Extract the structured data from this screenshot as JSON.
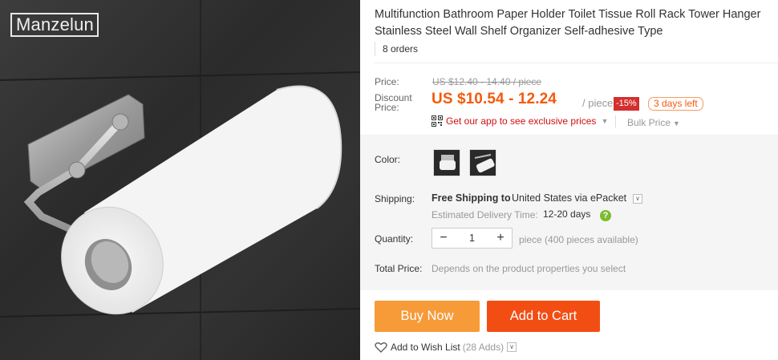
{
  "brand": "Manzelun",
  "product": {
    "title": "Multifunction Bathroom Paper Holder Toilet Tissue Roll Rack Tower Hanger Stainless Steel Wall Shelf Organizer Self-adhesive Type",
    "orders": "8 orders"
  },
  "pricing": {
    "price_label": "Price:",
    "original_price": "US $12.40 - 14.40 / piece",
    "discount_label_1": "Discount",
    "discount_label_2": "Price:",
    "discount_price": "US $10.54 - 12.24",
    "per_piece": "/ piece",
    "discount_badge": "-15%",
    "days_left": "3 days left",
    "app_promo": "Get our app to see exclusive prices",
    "bulk_price": "Bulk Price"
  },
  "options": {
    "color_label": "Color:",
    "shipping_label": "Shipping:",
    "shipping_free": "Free Shipping to",
    "shipping_dest": "United States via ePacket",
    "delivery_label": "Estimated Delivery Time:",
    "delivery_days": "12-20 days",
    "quantity_label": "Quantity:",
    "quantity_value": "1",
    "quantity_minus": "−",
    "quantity_plus": "+",
    "quantity_note": "piece (400 pieces available)",
    "total_label": "Total Price:",
    "total_value": "Depends on the product properties you select"
  },
  "actions": {
    "buy_now": "Buy Now",
    "add_to_cart": "Add to Cart",
    "wishlist": "Add to Wish List",
    "wishlist_count": "(28 Adds)"
  },
  "colors": {
    "accent_orange": "#f35a0c",
    "buy_now_bg": "#f79a38",
    "add_cart_bg": "#f24e14",
    "badge_red": "#d32f2f"
  },
  "icons": [
    "qr-code-icon",
    "chevron-down-icon",
    "check-circle-icon",
    "heart-icon"
  ]
}
